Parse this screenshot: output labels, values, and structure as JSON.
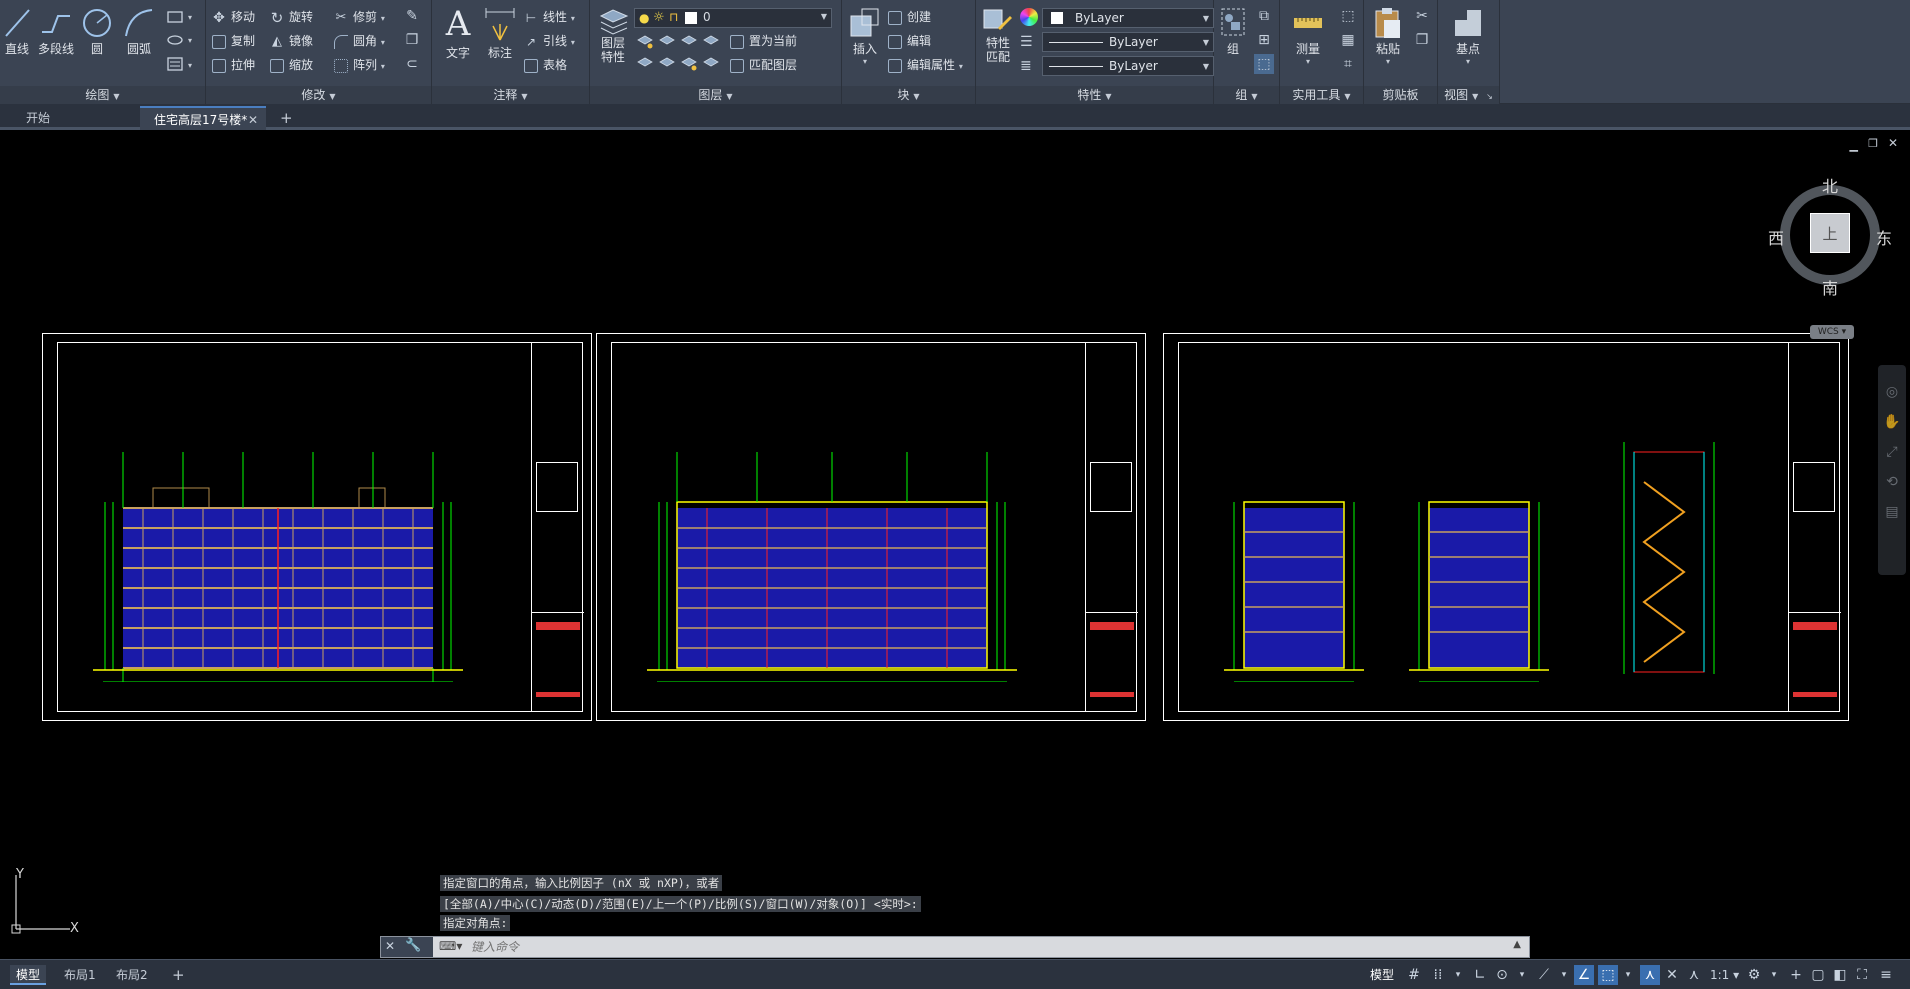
{
  "ribbon": {
    "draw": {
      "title": "绘图",
      "line": "直线",
      "polyline": "多段线",
      "circle": "圆",
      "arc": "圆弧"
    },
    "modify": {
      "title": "修改",
      "move": "移动",
      "rotate": "旋转",
      "trim": "修剪",
      "copy": "复制",
      "mirror": "镜像",
      "fillet": "圆角",
      "stretch": "拉伸",
      "scale": "缩放",
      "array": "阵列"
    },
    "annotation": {
      "title": "注释",
      "text": "文字",
      "dimension": "标注",
      "linear": "线性",
      "leader": "引线",
      "table": "表格"
    },
    "layers": {
      "title": "图层",
      "layer_properties": "图层\n特性",
      "current_layer": "0",
      "set_current": "置为当前",
      "match_layer": "匹配图层"
    },
    "block": {
      "title": "块",
      "insert": "插入",
      "create": "创建",
      "edit": "编辑",
      "edit_attributes": "编辑属性"
    },
    "properties": {
      "title": "特性",
      "match_properties": "特性\n匹配",
      "color": "ByLayer",
      "linetype": "ByLayer",
      "lineweight": "ByLayer"
    },
    "groups": {
      "title": "组",
      "group": "组"
    },
    "utilities": {
      "title": "实用工具",
      "measure": "测量"
    },
    "clipboard": {
      "title": "剪贴板",
      "paste": "粘贴"
    },
    "view": {
      "title": "视图",
      "base": "基点"
    }
  },
  "tabs": {
    "start": "开始",
    "document": "住宅高层17号楼*",
    "add": "+"
  },
  "viewcube": {
    "north": "北",
    "south": "南",
    "east": "东",
    "west": "西",
    "face": "上",
    "wcs": "WCS"
  },
  "ucs": {
    "x": "X",
    "y": "Y"
  },
  "command": {
    "history": [
      "指定窗口的角点，输入比例因子 (nX 或 nXP)，或者",
      "[全部(A)/中心(C)/动态(D)/范围(E)/上一个(P)/比例(S)/窗口(W)/对象(O)] <实时>:",
      "指定对角点:"
    ],
    "placeholder": "键入命令"
  },
  "layouts": {
    "model": "模型",
    "layout1": "布局1",
    "layout2": "布局2",
    "add": "+"
  },
  "status": {
    "model_label": "模型",
    "scale": "1:1"
  },
  "colors": {
    "ribbon_bg": "#3b4453",
    "canvas_bg": "#000000",
    "drawing_green": "#00ff00",
    "drawing_blue": "#0000ff",
    "drawing_red": "#ff0000",
    "accent_blue": "#4a7ec0"
  }
}
